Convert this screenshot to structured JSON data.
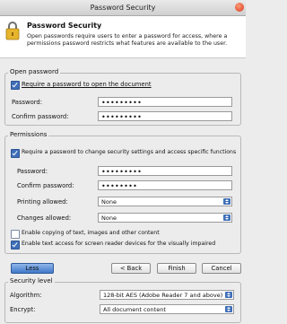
{
  "window": {
    "title": "Password Security"
  },
  "header": {
    "title": "Password Security",
    "description": "Open passwords require users to enter a password for access, where a permissions password restricts what features are available to the user."
  },
  "open_password": {
    "legend": "Open password",
    "require_label": "Require a password to open the document",
    "require_checked": true,
    "password_label": "Password:",
    "password_value": "•••••••••",
    "confirm_label": "Confirm password:",
    "confirm_value": "•••••••••"
  },
  "permissions": {
    "legend": "Permissions",
    "require_label": "Require a password to change security settings and access specific functions",
    "require_checked": true,
    "password_label": "Password:",
    "password_value": "•••••••••",
    "confirm_label": "Confirm password:",
    "confirm_value": "••••••••",
    "printing_label": "Printing allowed:",
    "printing_value": "None",
    "changes_label": "Changes allowed:",
    "changes_value": "None",
    "copy_label": "Enable copying of text, images and other content",
    "copy_checked": false,
    "access_label": "Enable text access for screen reader devices for the visually impaired",
    "access_checked": true
  },
  "buttons": {
    "less": "Less",
    "back": "< Back",
    "finish": "Finish",
    "cancel": "Cancel"
  },
  "security_level": {
    "legend": "Security level",
    "algorithm_label": "Algorithm:",
    "algorithm_value": "128-bit AES (Adobe Reader 7 and above)",
    "encrypt_label": "Encrypt:",
    "encrypt_value": "All document content"
  },
  "colors": {
    "accent": "#3f6fb8",
    "title_bar": "#dcdcdc",
    "background": "#ececec"
  }
}
